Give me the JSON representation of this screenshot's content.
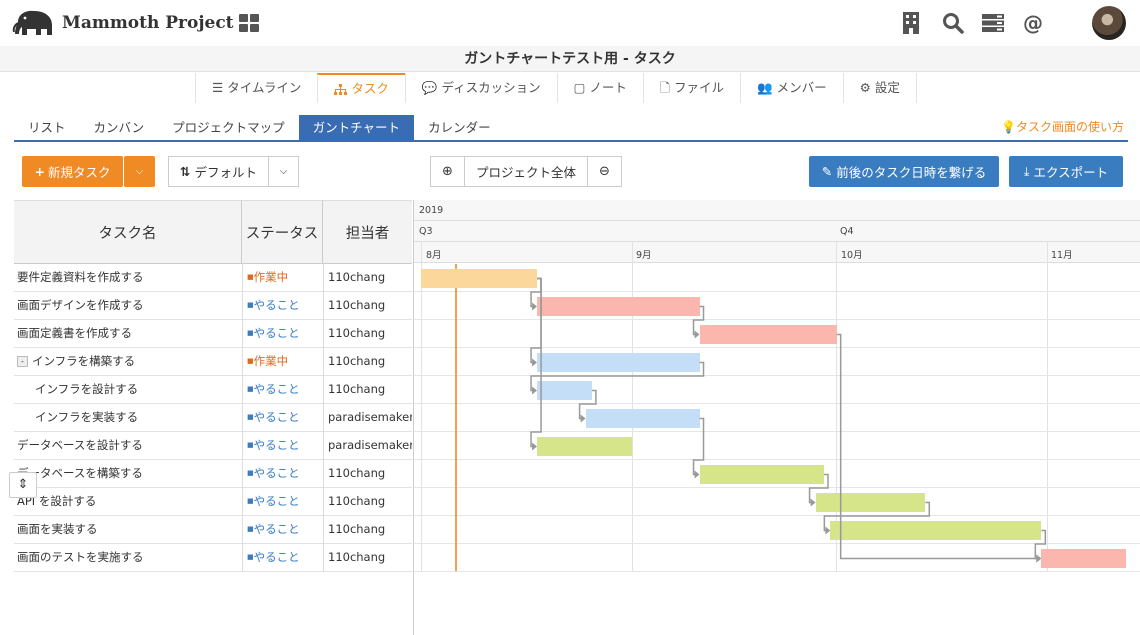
{
  "app": {
    "logo_text": "Mammoth Project",
    "page_title": "ガントチャートテスト用 - タスク"
  },
  "header_icons": [
    "building-icon",
    "search-icon",
    "server-icon",
    "at-icon"
  ],
  "main_tabs": [
    {
      "label": "タイムライン",
      "icon": "list-icon"
    },
    {
      "label": "タスク",
      "icon": "sitemap-icon",
      "active": true
    },
    {
      "label": "ディスカッション",
      "icon": "comments-icon"
    },
    {
      "label": "ノート",
      "icon": "note-icon"
    },
    {
      "label": "ファイル",
      "icon": "file-icon"
    },
    {
      "label": "メンバー",
      "icon": "users-icon"
    },
    {
      "label": "設定",
      "icon": "gear-icon"
    }
  ],
  "sub_tabs": [
    {
      "label": "リスト"
    },
    {
      "label": "カンバン"
    },
    {
      "label": "プロジェクトマップ"
    },
    {
      "label": "ガントチャート",
      "active": true
    },
    {
      "label": "カレンダー"
    }
  ],
  "help_link": "タスク画面の使い方",
  "toolbar": {
    "new_task": "新規タスク",
    "sort_default": "デフォルト",
    "zoom_label": "プロジェクト全体",
    "link_dates": "前後のタスク日時を繋げる",
    "export": "エクスポート"
  },
  "table": {
    "headers": {
      "name": "タスク名",
      "status": "ステータス",
      "assignee": "担当者"
    },
    "rows": [
      {
        "name": "要件定義資料を作成する",
        "status": "作業中",
        "status_kind": "doing",
        "assignee": "110chang",
        "indent": 0
      },
      {
        "name": "画面デザインを作成する",
        "status": "やること",
        "status_kind": "todo",
        "assignee": "110chang",
        "indent": 0
      },
      {
        "name": "画面定義書を作成する",
        "status": "やること",
        "status_kind": "todo",
        "assignee": "110chang",
        "indent": 0
      },
      {
        "name": "インフラを構築する",
        "status": "作業中",
        "status_kind": "doing",
        "assignee": "110chang",
        "indent": 0,
        "collapse": true
      },
      {
        "name": "インフラを設計する",
        "status": "やること",
        "status_kind": "todo",
        "assignee": "110chang",
        "indent": 1
      },
      {
        "name": "インフラを実装する",
        "status": "やること",
        "status_kind": "todo",
        "assignee": "paradisemaker",
        "indent": 1
      },
      {
        "name": "データベースを設計する",
        "status": "やること",
        "status_kind": "todo",
        "assignee": "paradisemaker",
        "indent": 0
      },
      {
        "name": "データベースを構築する",
        "status": "やること",
        "status_kind": "todo",
        "assignee": "110chang",
        "indent": 0
      },
      {
        "name": "API を設計する",
        "status": "やること",
        "status_kind": "todo",
        "assignee": "110chang",
        "indent": 0
      },
      {
        "name": "画面を実装する",
        "status": "やること",
        "status_kind": "todo",
        "assignee": "110chang",
        "indent": 0
      },
      {
        "name": "画面のテストを実施する",
        "status": "やること",
        "status_kind": "todo",
        "assignee": "110chang",
        "indent": 0
      }
    ]
  },
  "gantt": {
    "year": "2019",
    "quarters": [
      "Q3",
      "Q4"
    ],
    "months": [
      "8月",
      "9月",
      "10月",
      "11月"
    ],
    "colors": {
      "orange": "#fcd79b",
      "red": "#fbb7ad",
      "blue": "#c5def7",
      "green": "#d6e58a",
      "today": "#f3a252",
      "arrow": "#999999"
    },
    "bars": [
      {
        "color": "orange",
        "start": 0.0,
        "end": 0.55
      },
      {
        "color": "red",
        "start": 0.55,
        "end": 1.32
      },
      {
        "color": "red",
        "start": 1.32,
        "end": 1.97
      },
      {
        "color": "blue",
        "start": 0.55,
        "end": 1.32
      },
      {
        "color": "blue",
        "start": 0.55,
        "end": 0.81
      },
      {
        "color": "blue",
        "start": 0.78,
        "end": 1.32
      },
      {
        "color": "green",
        "start": 0.55,
        "end": 1.0
      },
      {
        "color": "green",
        "start": 1.32,
        "end": 1.91
      },
      {
        "color": "green",
        "start": 1.87,
        "end": 2.39
      },
      {
        "color": "green",
        "start": 1.94,
        "end": 2.94
      },
      {
        "color": "red",
        "start": 2.94,
        "end": 3.34
      }
    ],
    "today": 0.16
  }
}
